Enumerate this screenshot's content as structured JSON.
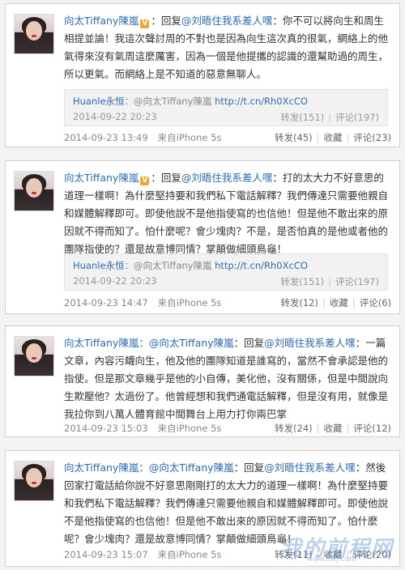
{
  "posts": [
    {
      "user": "向太Tiffany陳嵐",
      "reply_prefix": "：回复",
      "mention": "@刘晤住我系差人嘿",
      "text": "：你不可以將向生和周生相提並論！我這次聲討周的不對也是因為向生這次真的很氣，網絡上的他氣得來沒有氣周這麼厲害，因為一個是他提攜的認識的還幫助過的周生，所以更氣。而網絡上是不知道的惡意無聊人。",
      "quote": {
        "user": "Huanle永恒",
        "text": "：@向太Tiffany陳嵐",
        "link": "http://t.cn/Rh0XcCO",
        "time": "2014-09-22 20:23",
        "repost": "转发(151)",
        "comment": "评论(197)"
      },
      "time": "2014-09-23 13:49",
      "source": "来自iPhone 5s",
      "repost": "转发(45)",
      "collect": "收藏",
      "comment": "评论(23)"
    },
    {
      "user": "向太Tiffany陳嵐",
      "reply_prefix": "：回复",
      "mention": "@刘晤住我系差人嘿",
      "text": "：打的太大力不好意思的道理一樣啊！為什麼堅持要和我們私下電話解釋？我們傳達只需要他親自和媒體解釋即可。即使他說不是他指使寫的也信他！但是他不敢出來的原因就不得而知了。怕什麼呢？會少塊肉？不是，是否怕真的是他或者他的團隊指使的？還是故意博同情？掌顛做細頭鳥龜！",
      "quote": {
        "user": "Huanle永恒",
        "text": "：@向太Tiffany陳嵐",
        "link": "http://t.cn/Rh0XcCO",
        "time": "2014-09-22 20:23",
        "repost": "转发(151)",
        "comment": "评论(197)"
      },
      "time": "2014-09-23 14:47",
      "source": "来自iPhone 5s",
      "repost": "转发(12)",
      "collect": "收藏",
      "comment": "评论(6)"
    },
    {
      "user": "向太Tiffany陳嵐",
      "mention0": "：@向太Tiffany陳嵐",
      "reply_prefix": "：回复",
      "mention": "@刘晤住我系差人嘿",
      "text": "：一篇文章，內容污衊向生，他及他的團隊知道是誰寫的，當然不會承認是他的指使。但是那文章幾乎是他的小自傳，美化他，沒有關係，但是中間說向生欺壓他？太過份了。他曾經想和我們通電話解釋，但是沒有用，就像是我拉你到八萬人體育館中間舞台上用力打你兩巴掌",
      "time": "2014-09-23 15:03",
      "source": "来自iPhone 5s",
      "repost": "转发(24)",
      "collect": "收藏",
      "comment": "评论(12)"
    },
    {
      "user": "向太Tiffany陳嵐",
      "mention0": "：@向太Tiffany陳嵐",
      "reply_prefix": "：回复",
      "mention": "@刘晤住我系差人嘿",
      "text": "：然後回家打電話給你說不好意思剛剛打的太大力的道理一樣啊！為什麼堅持要和我們私下電話解釋？我們傳達只需要他親自和媒體解釋即可。即使他說不是他指使寫的也信他！但是他不敢出來的原因就不得而知了。怕什麼呢？會少塊肉？還是故意博同情？掌顛做細頭鳥龜！",
      "time": "2014-09-23 15:07",
      "source": "来自iPhone 5s",
      "repost": "转发(11)",
      "collect": "收藏",
      "comment": "评论(20)"
    }
  ],
  "verified_badge": "V",
  "watermark": "我的前程网",
  "watermark_url": "www.5sij.com"
}
